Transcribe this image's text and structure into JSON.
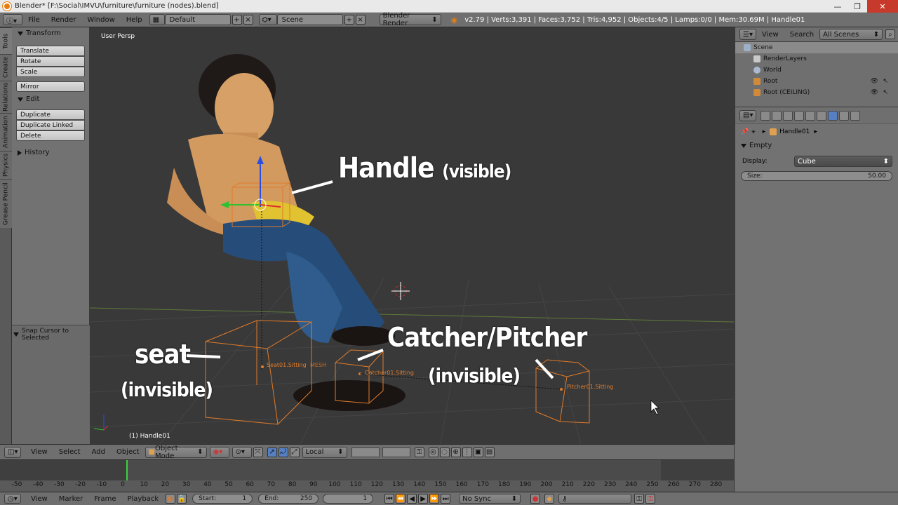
{
  "window": {
    "title": "Blender* [F:\\Social\\IMVU\\furniture\\furniture (nodes).blend]",
    "minimize": "—",
    "maximize": "❐",
    "close": "✕"
  },
  "infobar": {
    "menus": [
      "File",
      "Render",
      "Window",
      "Help"
    ],
    "layout": "Default",
    "scene": "Scene",
    "engine": "Blender Render",
    "stats": "v2.79 | Verts:3,391 | Faces:3,752 | Tris:4,952 | Objects:4/5 | Lamps:0/0 | Mem:30.69M | Handle01"
  },
  "lefttabs": [
    "Tools",
    "Create",
    "Relations",
    "Animation",
    "Physics",
    "Grease Pencil"
  ],
  "toolshelf": {
    "transform_header": "Transform",
    "transform_buttons": [
      "Translate",
      "Rotate",
      "Scale"
    ],
    "mirror": "Mirror",
    "edit_header": "Edit",
    "edit_buttons": [
      "Duplicate",
      "Duplicate Linked",
      "Delete"
    ],
    "history_header": "History",
    "snap_label": "Snap Cursor to Selected"
  },
  "viewport": {
    "view_label": "User Persp",
    "object_label": "(1) Handle01",
    "annotations": {
      "handle_title": "Handle",
      "handle_sub": "(visible)",
      "seat_title": "seat",
      "seat_sub": "(invisible)",
      "catcher_title": "Catcher/Pitcher",
      "catcher_sub": "(invisible)"
    },
    "object_labels": {
      "seat": "Seat01.Sitting",
      "mesh": "MESH",
      "catcher": "Catcher01.Sitting",
      "pitcher": "Pitcher01.Sitting"
    }
  },
  "outliner": {
    "view": "View",
    "search": "Search",
    "filter": "All Scenes",
    "rows": [
      "Scene",
      "RenderLayers",
      "World",
      "Root",
      "Root (CEILING)"
    ]
  },
  "properties": {
    "object_name": "Handle01",
    "panel": "Empty",
    "display_label": "Display:",
    "display_value": "Cube",
    "size_label": "Size:",
    "size_value": "50.00"
  },
  "vp_header": {
    "menus": [
      "View",
      "Select",
      "Add",
      "Object"
    ],
    "mode": "Object Mode",
    "orientation": "Local"
  },
  "timeline": {
    "ticks": [
      "-50",
      "-40",
      "-30",
      "-20",
      "-10",
      "0",
      "10",
      "20",
      "30",
      "40",
      "50",
      "60",
      "70",
      "80",
      "90",
      "100",
      "110",
      "120",
      "130",
      "140",
      "150",
      "160",
      "170",
      "180",
      "190",
      "200",
      "210",
      "220",
      "230",
      "240",
      "250",
      "260",
      "270",
      "280"
    ],
    "current_frame": 1
  },
  "tl_header": {
    "menus": [
      "View",
      "Marker",
      "Frame",
      "Playback"
    ],
    "start_label": "Start:",
    "start_value": "1",
    "end_label": "End:",
    "end_value": "250",
    "frame_value": "1",
    "sync": "No Sync"
  }
}
